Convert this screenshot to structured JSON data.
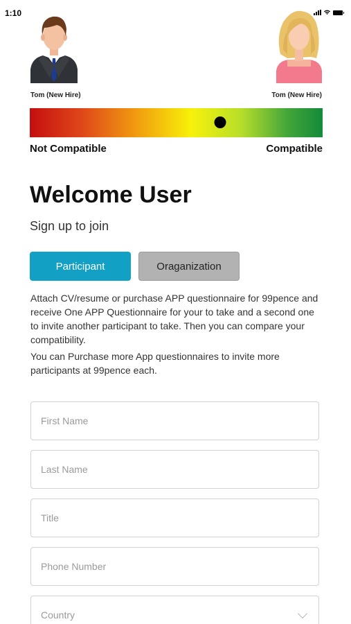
{
  "status": {
    "time": "1:10"
  },
  "profiles": {
    "left": {
      "name": "Tom (New Hire)",
      "icon": "male-avatar-icon"
    },
    "right": {
      "name": "Tom (New Hire)",
      "icon": "female-avatar-icon"
    }
  },
  "compatibility": {
    "low_label": "Not Compatible",
    "high_label": "Compatible",
    "level": 0.65,
    "gradient_colors": [
      "#c40f0f",
      "#f2a30f",
      "#f7f10a",
      "#148a3a"
    ]
  },
  "welcome": {
    "title": "Welcome User",
    "subtitle": "Sign up to join"
  },
  "tabs": [
    {
      "label": "Participant",
      "active": true,
      "color": "#12a0c5"
    },
    {
      "label": "Oraganization",
      "active": false,
      "color": "#b2b2b2"
    }
  ],
  "description": {
    "para1": "Attach CV/resume or purchase APP questionnaire for 99pence and receive One APP Questionnaire for your to take and a second one to invite another participant to take. Then you can compare your compatibility.",
    "para2": "You can Purchase more App questionnaires to invite more participants at 99pence each."
  },
  "form": {
    "first_name_placeholder": "First Name",
    "last_name_placeholder": "Last Name",
    "title_placeholder": "Title",
    "phone_placeholder": "Phone Number",
    "country_placeholder": "Country"
  }
}
